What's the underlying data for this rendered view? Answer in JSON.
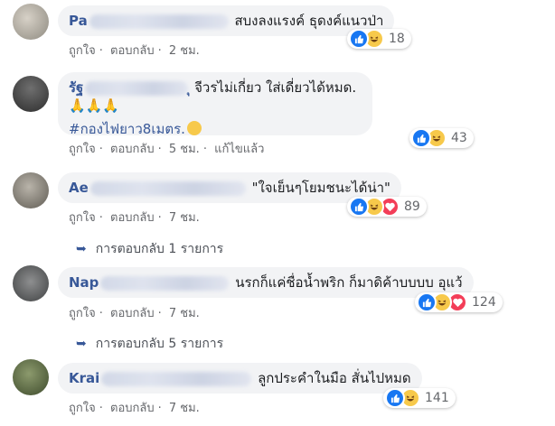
{
  "comments": [
    {
      "name_prefix": "Pa",
      "text": "สบงลงแรงค์ ธุดงค์แนวป่า",
      "actions": {
        "like": "ถูกใจ",
        "reply": "ตอบกลับ",
        "time": "2 ชม."
      },
      "reaction_count": "18"
    },
    {
      "name_prefix": "รัฐ",
      "name_suffix": "ุ",
      "text": "จีวรไม่เกี่ยว ใส่เดี่ยวได้หมด.🙏🙏🙏",
      "hashtag": "#กองไฟยาว8เมตร.",
      "actions": {
        "like": "ถูกใจ",
        "reply": "ตอบกลับ",
        "time": "5 ชม.",
        "edited": "แก้ไขแล้ว"
      },
      "reaction_count": "43"
    },
    {
      "name_prefix": "Ae",
      "text": "\"ใจเย็นๆโยมชนะได้น่า\"",
      "actions": {
        "like": "ถูกใจ",
        "reply": "ตอบกลับ",
        "time": "7 ชม."
      },
      "reaction_count": "89",
      "replies": "การตอบกลับ 1 รายการ"
    },
    {
      "name_prefix": "Nap",
      "text": "นรกก็แค่ชื่อน้ำพริก ก็มาดิค้าบบบบ อุแว้",
      "actions": {
        "like": "ถูกใจ",
        "reply": "ตอบกลับ",
        "time": "7 ชม."
      },
      "reaction_count": "124",
      "replies": "การตอบกลับ 5 รายการ"
    },
    {
      "name_prefix": "Krai",
      "text": "ลูกประคำในมือ สั่นไปหมด",
      "actions": {
        "like": "ถูกใจ",
        "reply": "ตอบกลับ",
        "time": "7 ชม."
      },
      "reaction_count": "141"
    }
  ],
  "colors": {
    "name": "#385898",
    "bubble": "#f2f3f5",
    "like": "#1877f2",
    "haha": "#f7c94b",
    "love": "#f33e58"
  },
  "icons": [
    "like-reaction-icon",
    "haha-reaction-icon",
    "love-reaction-icon",
    "reply-arrow-icon",
    "praying-hands-emoji",
    "laughing-emoji"
  ]
}
